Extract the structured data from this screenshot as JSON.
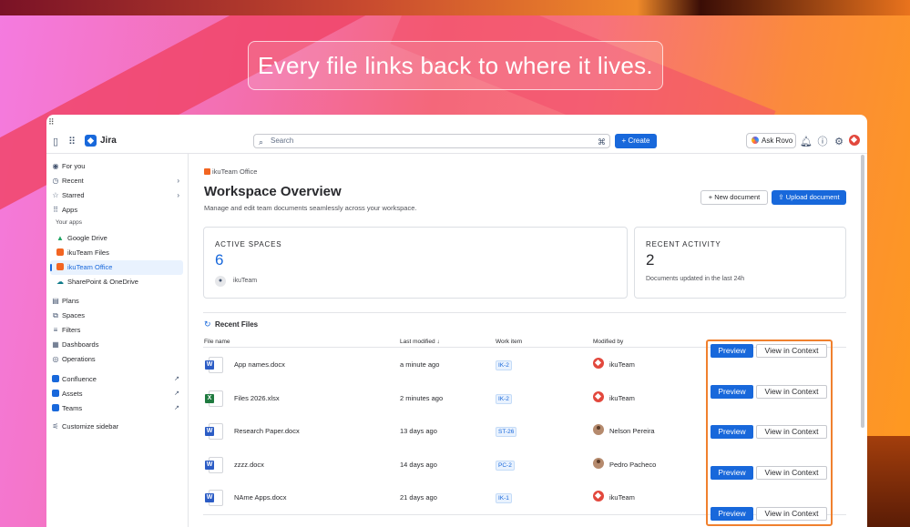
{
  "tagline": "Every file links back to where it lives.",
  "topbar": {
    "app_name": "Jira",
    "search_placeholder": "Search",
    "create_label": "+ Create",
    "ask_rovo_label": "Ask Rovo"
  },
  "sidebar": {
    "for_you": "For you",
    "recent": "Recent",
    "starred": "Starred",
    "apps": "Apps",
    "your_apps_heading": "Your apps",
    "app_items": [
      "Google Drive",
      "ikuTeam Files",
      "ikuTeam Office",
      "SharePoint & OneDrive"
    ],
    "plans": "Plans",
    "spaces": "Spaces",
    "filters": "Filters",
    "dashboards": "Dashboards",
    "operations": "Operations",
    "confluence": "Confluence",
    "assets": "Assets",
    "teams": "Teams",
    "customize": "Customize sidebar"
  },
  "main": {
    "breadcrumb": "ikuTeam Office",
    "title": "Workspace Overview",
    "subtitle": "Manage and edit team documents seamlessly across your workspace.",
    "new_document": "+ New document",
    "upload_document": "Upload document",
    "active_spaces": {
      "label": "ACTIVE SPACES",
      "value": "6",
      "team": "ikuTeam"
    },
    "recent_activity": {
      "label": "RECENT ACTIVITY",
      "value": "2",
      "note": "Documents updated in the last 24h"
    },
    "recent_files_heading": "Recent Files",
    "columns": {
      "file_name": "File name",
      "last_modified": "Last modified",
      "work_item": "Work item",
      "modified_by": "Modified by"
    },
    "files": [
      {
        "name": "App names.docx",
        "type": "W",
        "modified": "a minute ago",
        "work_item": "IK-2",
        "by": "ikuTeam",
        "avatar": "iku"
      },
      {
        "name": "Files 2026.xlsx",
        "type": "X",
        "modified": "2 minutes ago",
        "work_item": "IK-2",
        "by": "ikuTeam",
        "avatar": "iku"
      },
      {
        "name": "Research Paper.docx",
        "type": "W",
        "modified": "13 days ago",
        "work_item": "ST-26",
        "by": "Nelson Pereira",
        "avatar": "person"
      },
      {
        "name": "zzzz.docx",
        "type": "W",
        "modified": "14 days ago",
        "work_item": "PC-2",
        "by": "Pedro Pacheco",
        "avatar": "person"
      },
      {
        "name": "NAme Apps.docx",
        "type": "W",
        "modified": "21 days ago",
        "work_item": "IK-1",
        "by": "ikuTeam",
        "avatar": "iku"
      }
    ],
    "preview_label": "Preview",
    "view_context_label": "View in Context"
  },
  "colors": {
    "accent": "#1868db",
    "highlight": "#f0802e",
    "word": "#2b5cc5",
    "excel": "#1f7a3f"
  }
}
